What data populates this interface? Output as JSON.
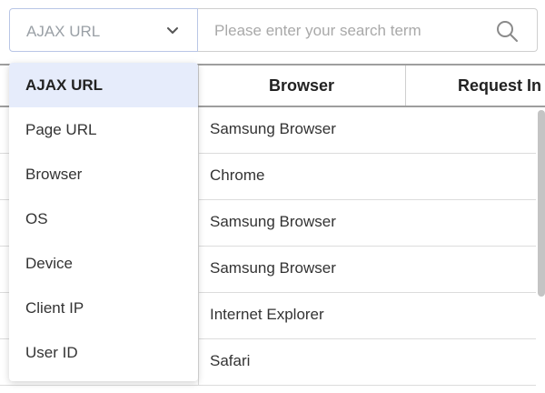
{
  "search": {
    "select_value": "AJAX URL",
    "placeholder": "Please enter your search term",
    "dropdown_options": [
      "AJAX URL",
      "Page URL",
      "Browser",
      "OS",
      "Device",
      "Client IP",
      "User ID"
    ],
    "selected_index": 0
  },
  "table": {
    "headers": {
      "browser": "Browser",
      "request": "Request In"
    },
    "rows": [
      {
        "browser": "Samsung Browser"
      },
      {
        "browser": "Chrome"
      },
      {
        "browser": "Samsung Browser"
      },
      {
        "browser": "Samsung Browser"
      },
      {
        "browser": "Internet Explorer"
      },
      {
        "browser": "Safari"
      }
    ]
  },
  "icons": {
    "select_arrow": "chevron-down-icon",
    "search": "search-icon"
  },
  "colors": {
    "selected_bg": "#e6ecfb",
    "select_border": "#b9c6e6"
  }
}
